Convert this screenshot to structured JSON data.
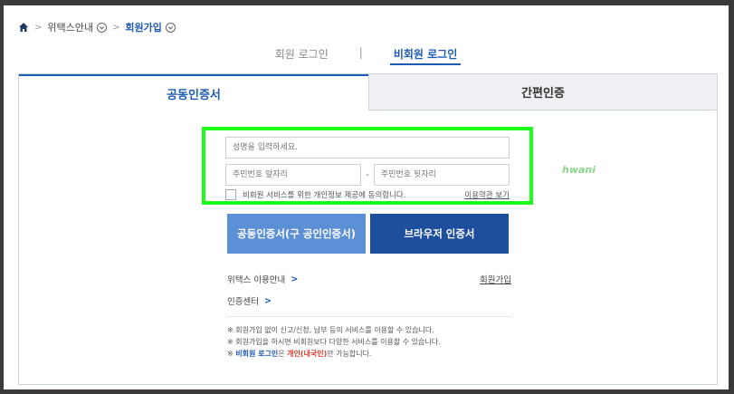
{
  "breadcrumb": {
    "home_icon": "home-icon",
    "item1": "위택스안내",
    "item2": "회원가입"
  },
  "login_switch": {
    "member": "회원 로그인",
    "divider": "|",
    "nonmember": "비회원 로그인"
  },
  "tabs": {
    "cert": "공동인증서",
    "simple": "간편인증"
  },
  "form": {
    "name_placeholder": "성명을 입력하세요.",
    "id_front_placeholder": "주민번호 앞자리",
    "dash": "-",
    "id_back_placeholder": "주민번호 뒷자리",
    "agree_text": "비회원 서비스를 위한 개인정보 제공에 동의합니다.",
    "terms_link": "이용약관 보기"
  },
  "watermark": "hwani",
  "buttons": {
    "cert_login": "공동인증서(구 공인인증서)",
    "browser_cert": "브라우저 인증서"
  },
  "links": {
    "guide": "위택스 이용안내",
    "signup": "회원가입",
    "cert_center": "인증센터",
    "arrow": ">"
  },
  "notes": {
    "line1": "※ 회원가입 없이 신고/신청, 납부 등의 서비스를 이용할 수 있습니다.",
    "line2": "※ 회원가입을 하시면 비회원보다 다양한 서비스를 이용할 수 있습니다.",
    "line3_prefix": "※ ",
    "line3_blue": "비회원 로그인",
    "line3_mid": "은 ",
    "line3_red": "개인(내국인)",
    "line3_suffix": "만 가능합니다."
  },
  "colors": {
    "accent": "#1d5bb5",
    "highlight_border": "#1bff1b",
    "cert_button": "#5b8fd6",
    "browser_button": "#1d4f9c"
  }
}
